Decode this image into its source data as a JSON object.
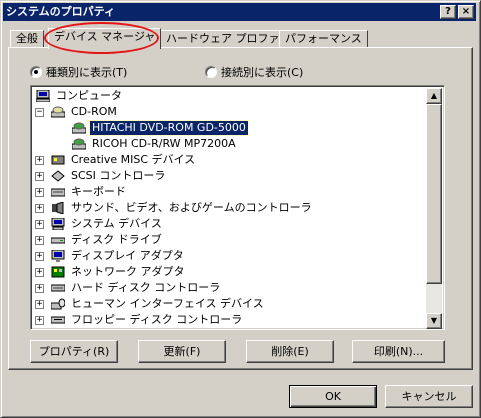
{
  "window": {
    "title": "システムのプロパティ",
    "help_btn": "?",
    "close_btn": "×"
  },
  "tabs": [
    "全般",
    "デバイス マネージャ",
    "ハードウェア プロファイル",
    "パフォーマンス"
  ],
  "radios": {
    "by_type": "種類別に表示(T)",
    "by_connection": "接続別に表示(C)"
  },
  "tree": [
    {
      "label": "コンピュータ",
      "icon": "computer-icon"
    },
    {
      "label": "CD-ROM",
      "icon": "cdrom-icon",
      "expanded": true
    },
    {
      "label": "HITACHI DVD-ROM GD-5000",
      "icon": "cdrom-drive-icon",
      "selected": true
    },
    {
      "label": "RICOH CD-R/RW MP7200A",
      "icon": "cdrom-drive-icon"
    },
    {
      "label": "Creative MISC デバイス",
      "icon": "device-icon"
    },
    {
      "label": "SCSI コントローラ",
      "icon": "scsi-icon"
    },
    {
      "label": "キーボード",
      "icon": "keyboard-icon"
    },
    {
      "label": "サウンド、ビデオ、およびゲームのコントローラ",
      "icon": "sound-icon"
    },
    {
      "label": "システム デバイス",
      "icon": "system-icon"
    },
    {
      "label": "ディスク ドライブ",
      "icon": "disk-drive-icon"
    },
    {
      "label": "ディスプレイ アダプタ",
      "icon": "display-icon"
    },
    {
      "label": "ネットワーク アダプタ",
      "icon": "network-icon"
    },
    {
      "label": "ハード ディスク コントローラ",
      "icon": "hdd-controller-icon"
    },
    {
      "label": "ヒューマン インターフェイス デバイス",
      "icon": "hid-icon"
    },
    {
      "label": "フロッピー ディスク コントローラ",
      "icon": "floppy-icon"
    }
  ],
  "buttons": {
    "properties": "プロパティ(R)",
    "refresh": "更新(F)",
    "remove": "削除(E)",
    "print": "印刷(N)..."
  },
  "footer": {
    "ok": "OK",
    "cancel": "キャンセル"
  },
  "colors": {
    "title_bar": "#0a246a",
    "selection": "#0a246a",
    "highlight_circle": "#e21616",
    "face": "#d4d0c8"
  }
}
